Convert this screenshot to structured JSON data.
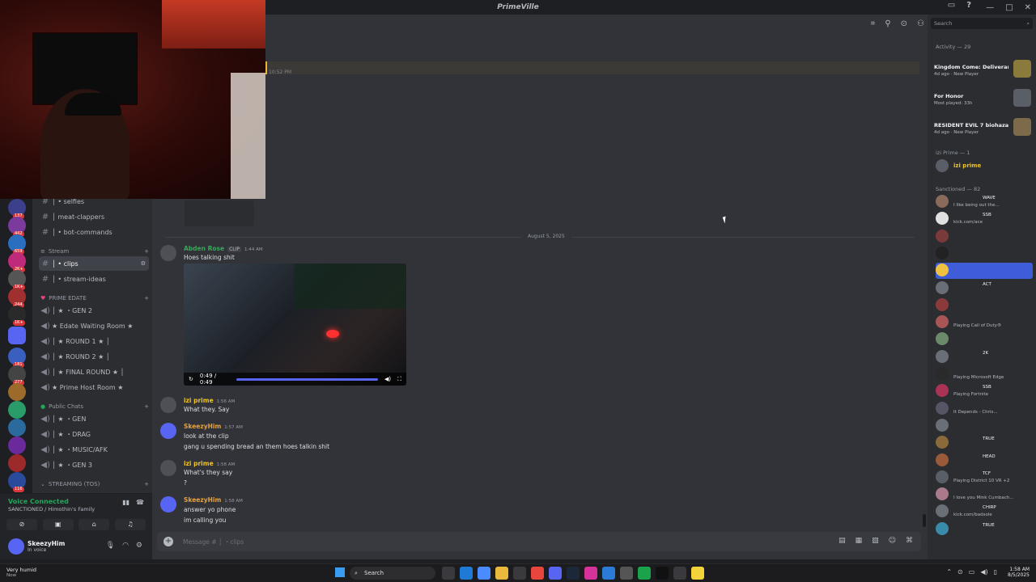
{
  "window": {
    "title": "PrimeVille"
  },
  "channels": {
    "items": [
      {
        "label": "│ • selfies"
      },
      {
        "label": "│ meat-clappers"
      },
      {
        "label": "│ • bot-commands"
      },
      {
        "label": "│ • clips"
      },
      {
        "label": "│ • stream-ideas"
      },
      {
        "label": "│ ★ ・GEN 2"
      },
      {
        "label": "★ Edate Waiting Room ★"
      },
      {
        "label": "│ ★ ROUND 1 ★ │"
      },
      {
        "label": "│ ★ ROUND 2 ★ │"
      },
      {
        "label": "│ ★ FINAL ROUND ★ │"
      },
      {
        "label": "★ Prime Host Room ★"
      },
      {
        "label": "│ ★ ・GEN"
      },
      {
        "label": "│ ★ ・DRAG"
      },
      {
        "label": "│ ★ ・MUSIC/AFK"
      },
      {
        "label": "│ ★ ・GEN 3"
      }
    ],
    "categories": {
      "stream": "Stream",
      "prime_edate": "PRIME EDATE",
      "public_chats": "Public Chats",
      "streaming": "STREAMING (TOS)"
    }
  },
  "servers": {
    "badges": [
      "137",
      "442",
      "659",
      "2K+",
      "1K+",
      "244",
      "1K+",
      "181",
      "277",
      "116"
    ]
  },
  "voice": {
    "status": "Voice Connected",
    "channel": "SANCTIONED / Himothin's Family"
  },
  "user": {
    "name": "SkeezyHim",
    "status": "In voice"
  },
  "chat": {
    "highlight_time": "10:52 PM",
    "date_divider": "August 5, 2025",
    "composer_placeholder": "Message # │ ・clips",
    "messages": [
      {
        "author": "Abden Rose",
        "tag": "CLIP",
        "time": "1:44 AM",
        "lines": [
          "Hoes talking shit"
        ],
        "color": "#3ba55d"
      },
      {
        "author": "izi prime",
        "time": "1:56 AM",
        "lines": [
          "What they. Say"
        ],
        "color": "#f0c420"
      },
      {
        "author": "SkeezyHim",
        "time": "1:57 AM",
        "lines": [
          "look at the clip",
          "gang u spending bread an them hoes talkin shit"
        ],
        "color": "#e6a23c"
      },
      {
        "author": "izi prime",
        "time": "1:58 AM",
        "lines": [
          "What's they say",
          "?"
        ],
        "color": "#f0c420"
      },
      {
        "author": "SkeezyHim",
        "time": "1:58 AM",
        "lines": [
          "answer yo phone",
          "im calling you"
        ],
        "color": "#e6a23c"
      }
    ],
    "video_time": "0:49 / 0:49"
  },
  "members": {
    "search_placeholder": "Search",
    "activity_header": "Activity — 29",
    "activities": [
      {
        "game": "Kingdom Come: Deliverance",
        "sub": "4d ago · New Player"
      },
      {
        "game": "For Honor",
        "sub": "Most played: 33h"
      },
      {
        "game": "RESIDENT EVIL 7 biohazard...",
        "sub": "4d ago · New Player"
      }
    ],
    "izi_header": "izi Prime — 1",
    "izi_member": "izi prime",
    "sanctioned_header": "Sanctioned — 82",
    "rows": [
      {
        "name": "",
        "tag": "WAVE",
        "status": "I like being out the..."
      },
      {
        "name": "",
        "tag": "SSB",
        "status": "kick.com/ace"
      },
      {
        "name": "",
        "tag": "",
        "status": ""
      },
      {
        "name": "",
        "tag": "",
        "status": ""
      },
      {
        "name": "",
        "tag": "",
        "status": ""
      },
      {
        "name": "",
        "tag": "ACT",
        "status": ""
      },
      {
        "name": "",
        "tag": "",
        "status": ""
      },
      {
        "name": "",
        "tag": "",
        "status": "Playing Call of Duty®"
      },
      {
        "name": "",
        "tag": "",
        "status": ""
      },
      {
        "name": "",
        "tag": "2K",
        "status": ""
      },
      {
        "name": "",
        "tag": "",
        "status": "Playing Microsoft Edge"
      },
      {
        "name": "",
        "tag": "SSB",
        "status": "Playing Fortnite"
      },
      {
        "name": "",
        "tag": "",
        "status": "It Depends - Chris..."
      },
      {
        "name": "",
        "tag": "",
        "status": ""
      },
      {
        "name": "",
        "tag": "TRUE",
        "status": ""
      },
      {
        "name": "",
        "tag": "HEAD",
        "status": ""
      },
      {
        "name": "",
        "tag": "TCF",
        "status": "Playing District 10 VR +2"
      },
      {
        "name": "",
        "tag": "",
        "status": "I love you Mink Cumbach..."
      },
      {
        "name": "",
        "tag": "CHIRP",
        "status": "kick.com/badsole"
      },
      {
        "name": "",
        "tag": "TRUE",
        "status": ""
      }
    ]
  },
  "taskbar": {
    "weather": "Very humid",
    "weather_sub": "Now",
    "search": "Search",
    "time": "1:58 AM",
    "date": "8/5/2025"
  }
}
